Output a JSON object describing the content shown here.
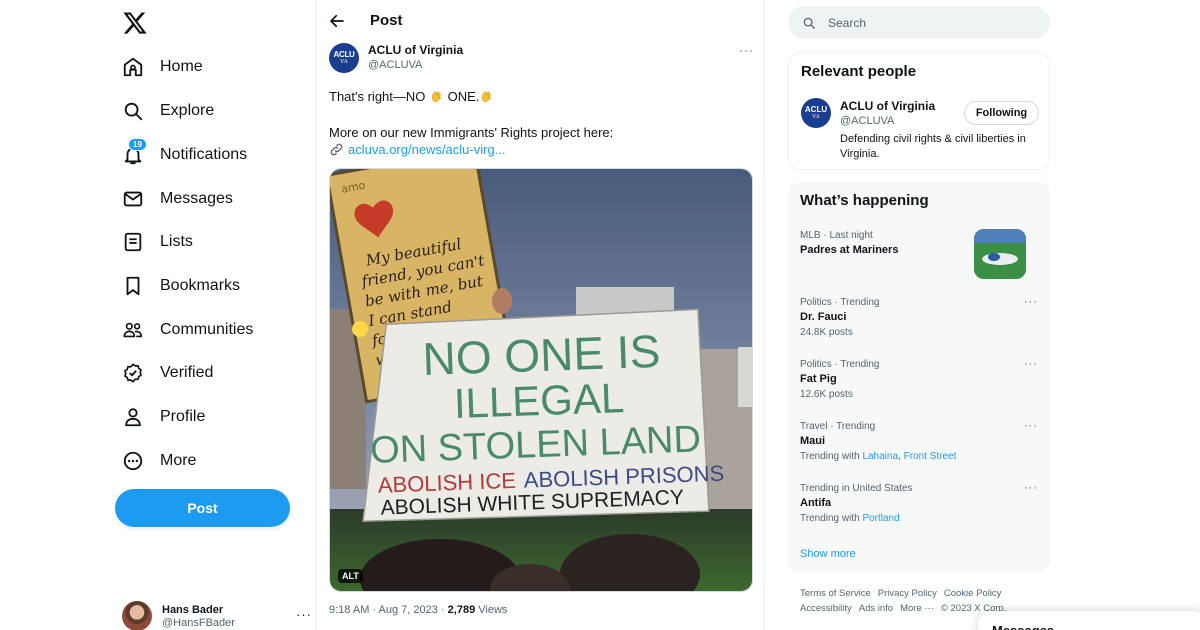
{
  "sidebar": {
    "logo": "x-logo-icon",
    "nav": [
      {
        "label": "Home",
        "icon": "home-icon"
      },
      {
        "label": "Explore",
        "icon": "search-icon"
      },
      {
        "label": "Notifications",
        "icon": "bell-icon",
        "badge": "19"
      },
      {
        "label": "Messages",
        "icon": "envelope-icon"
      },
      {
        "label": "Lists",
        "icon": "list-icon"
      },
      {
        "label": "Bookmarks",
        "icon": "bookmark-icon"
      },
      {
        "label": "Communities",
        "icon": "people-icon"
      },
      {
        "label": "Verified",
        "icon": "verified-icon"
      },
      {
        "label": "Profile",
        "icon": "person-icon"
      },
      {
        "label": "More",
        "icon": "more-circle-icon"
      }
    ],
    "post_button": "Post",
    "account": {
      "name": "Hans Bader",
      "handle": "@HansFBader",
      "more": "···"
    }
  },
  "main": {
    "header_title": "Post",
    "post": {
      "author_name": "ACLU of Virginia",
      "author_handle": "@ACLUVA",
      "avatar_text_top": "ACLU",
      "avatar_text_bottom": "VA",
      "more": "···",
      "text_line1_a": "That's right—NO ",
      "text_line1_b": " ONE.",
      "text_line2": "More on our new Immigrants' Rights project here:",
      "link": "acluva.org/news/aclu-virg...",
      "image": {
        "alt_badge": "ALT",
        "sign_left": [
          "My beautiful",
          "friend, you can't",
          "be with me, but",
          "I can stand",
          "for y",
          "want"
        ],
        "sign_left_top": "amo",
        "sign_main": [
          "NO ONE IS",
          "ILLEGAL",
          "ON STOLEN LAND"
        ],
        "sign_bottom_red": "ABOLISH ICE",
        "sign_bottom_blue": "ABOLISH PRISONS",
        "sign_bottom_black": "ABOLISH WHITE SUPREMACY"
      },
      "time": "9:18 AM",
      "date": "Aug 7, 2023",
      "views_count": "2,789",
      "views_label": "Views"
    }
  },
  "right": {
    "search_placeholder": "Search",
    "relevant": {
      "title": "Relevant people",
      "name": "ACLU of Virginia",
      "handle": "@ACLUVA",
      "bio": "Defending civil rights & civil liberties in Virginia.",
      "follow_label": "Following"
    },
    "happening": {
      "title": "What’s happening",
      "trends": [
        {
          "meta": "MLB · Last night",
          "title": "Padres at Mariners",
          "sub": ""
        },
        {
          "meta": "Politics · Trending",
          "title": "Dr. Fauci",
          "sub": "24.8K posts"
        },
        {
          "meta": "Politics · Trending",
          "title": "Fat Pig",
          "sub": "12.6K posts"
        },
        {
          "meta": "Travel · Trending",
          "title": "Maui",
          "sub_prefix": "Trending with ",
          "links": [
            "Lahaina",
            "Front Street"
          ]
        },
        {
          "meta": "Trending in United States",
          "title": "Antifa",
          "sub_prefix": "Trending with ",
          "links": [
            "Portland"
          ]
        }
      ],
      "show_more": "Show more"
    },
    "footer": {
      "links_row1": [
        "Terms of Service",
        "Privacy Policy",
        "Cookie Policy"
      ],
      "links_row2": [
        "Accessibility",
        "Ads info",
        "More ···",
        "© 2023 X Corp."
      ]
    },
    "messages_drawer": "Messages"
  },
  "colors": {
    "accent": "#1d9bf0",
    "text": "#0f1419",
    "muted": "#536471",
    "aclu_blue": "#1b3d8f"
  }
}
